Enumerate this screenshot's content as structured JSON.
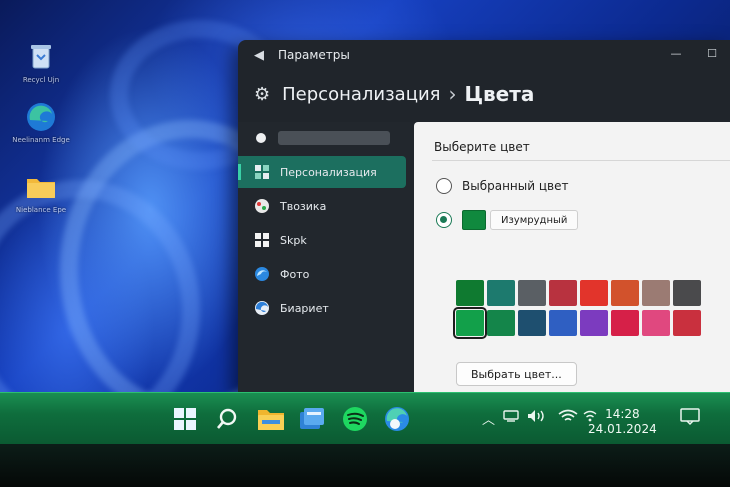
{
  "desktop": {
    "icons": [
      {
        "label": "Recycl Ujn",
        "icon": "recycle-bin-icon"
      },
      {
        "label": "Neelinanm Edge",
        "icon": "edge-icon"
      },
      {
        "label": "Nieblance Epe",
        "icon": "folder-icon"
      }
    ]
  },
  "window": {
    "title": "Параметры",
    "back_icon": "back-arrow-icon",
    "breadcrumb": {
      "parent": "Персонализация",
      "separator": "›",
      "current": "Цвета"
    }
  },
  "sidebar": {
    "items": [
      {
        "label": "Персонализация",
        "icon": "personalization-icon",
        "active": true
      },
      {
        "label": "Твозика",
        "icon": "paint-icon",
        "active": false
      },
      {
        "label": "Skpk",
        "icon": "windows-grid-icon",
        "active": false
      },
      {
        "label": "Фото",
        "icon": "photo-icon",
        "active": false
      },
      {
        "label": "Биариет",
        "icon": "browser-icon",
        "active": false
      }
    ]
  },
  "content": {
    "section_title": "Выберите цвет",
    "option_selected_label": "Выбранный цвет",
    "current_color_name": "Изумрудный",
    "current_color_hex": "#10893e",
    "pick_button": "Выбрать цвет...",
    "palette": [
      "#0f7a30",
      "#1d7a6e",
      "#5a5f64",
      "#b8323f",
      "#e2342b",
      "#d2522c",
      "#9b7b73",
      "#4a4a4c",
      "#12a04a",
      "#14854a",
      "#1e4f6f",
      "#2f5fc2",
      "#7c3bbf",
      "#d62048",
      "#e0487f",
      "#c9303e"
    ],
    "selected_index": 8
  },
  "taskbar": {
    "apps": [
      "windows-start-icon",
      "search-icon",
      "file-explorer-icon",
      "stacked-windows-icon",
      "spotify-icon",
      "edge-icon"
    ],
    "tray": [
      "chevron-up-icon",
      "network-device-icon",
      "volume-icon",
      "wifi-icon",
      "wifi-signal-icon"
    ],
    "time": "14:28",
    "date": "24.01.2024"
  }
}
